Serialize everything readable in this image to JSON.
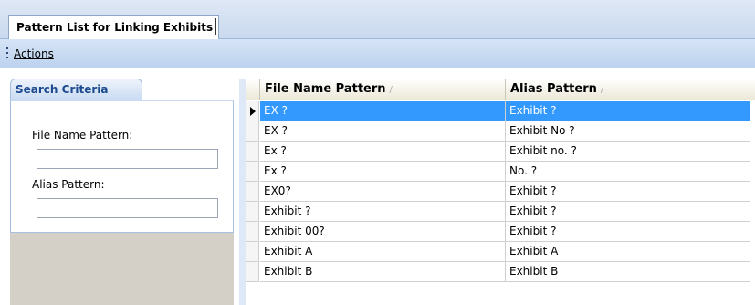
{
  "window": {
    "tab_title": "Pattern List for Linking Exhibits"
  },
  "actions_bar": {
    "actions_label": "Actions"
  },
  "search_panel": {
    "tab_label": "Search Criteria",
    "file_name_label": "File Name Pattern:",
    "file_name_value": "",
    "alias_label": "Alias Pattern:",
    "alias_value": ""
  },
  "grid": {
    "columns": [
      {
        "label": "File Name Pattern",
        "sort_indicator": "/"
      },
      {
        "label": "Alias Pattern",
        "sort_indicator": "/"
      }
    ],
    "selected_row_index": 0,
    "rows": [
      {
        "file_name_pattern": "EX ?",
        "alias_pattern": "Exhibit ?"
      },
      {
        "file_name_pattern": "EX ?",
        "alias_pattern": "Exhibit No ?"
      },
      {
        "file_name_pattern": "Ex ?",
        "alias_pattern": "Exhibit no. ?"
      },
      {
        "file_name_pattern": "Ex ?",
        "alias_pattern": "No. ?"
      },
      {
        "file_name_pattern": "EX0?",
        "alias_pattern": "Exhibit ?"
      },
      {
        "file_name_pattern": "Exhibit ?",
        "alias_pattern": "Exhibit ?"
      },
      {
        "file_name_pattern": "Exhibit 00?",
        "alias_pattern": "Exhibit ?"
      },
      {
        "file_name_pattern": "Exhibit A",
        "alias_pattern": "Exhibit A"
      },
      {
        "file_name_pattern": "Exhibit B",
        "alias_pattern": "Exhibit B"
      }
    ]
  },
  "colors": {
    "selection": "#3399ff",
    "header_accent": "#1c4a8e",
    "panel_gray": "#d4d0c8"
  }
}
